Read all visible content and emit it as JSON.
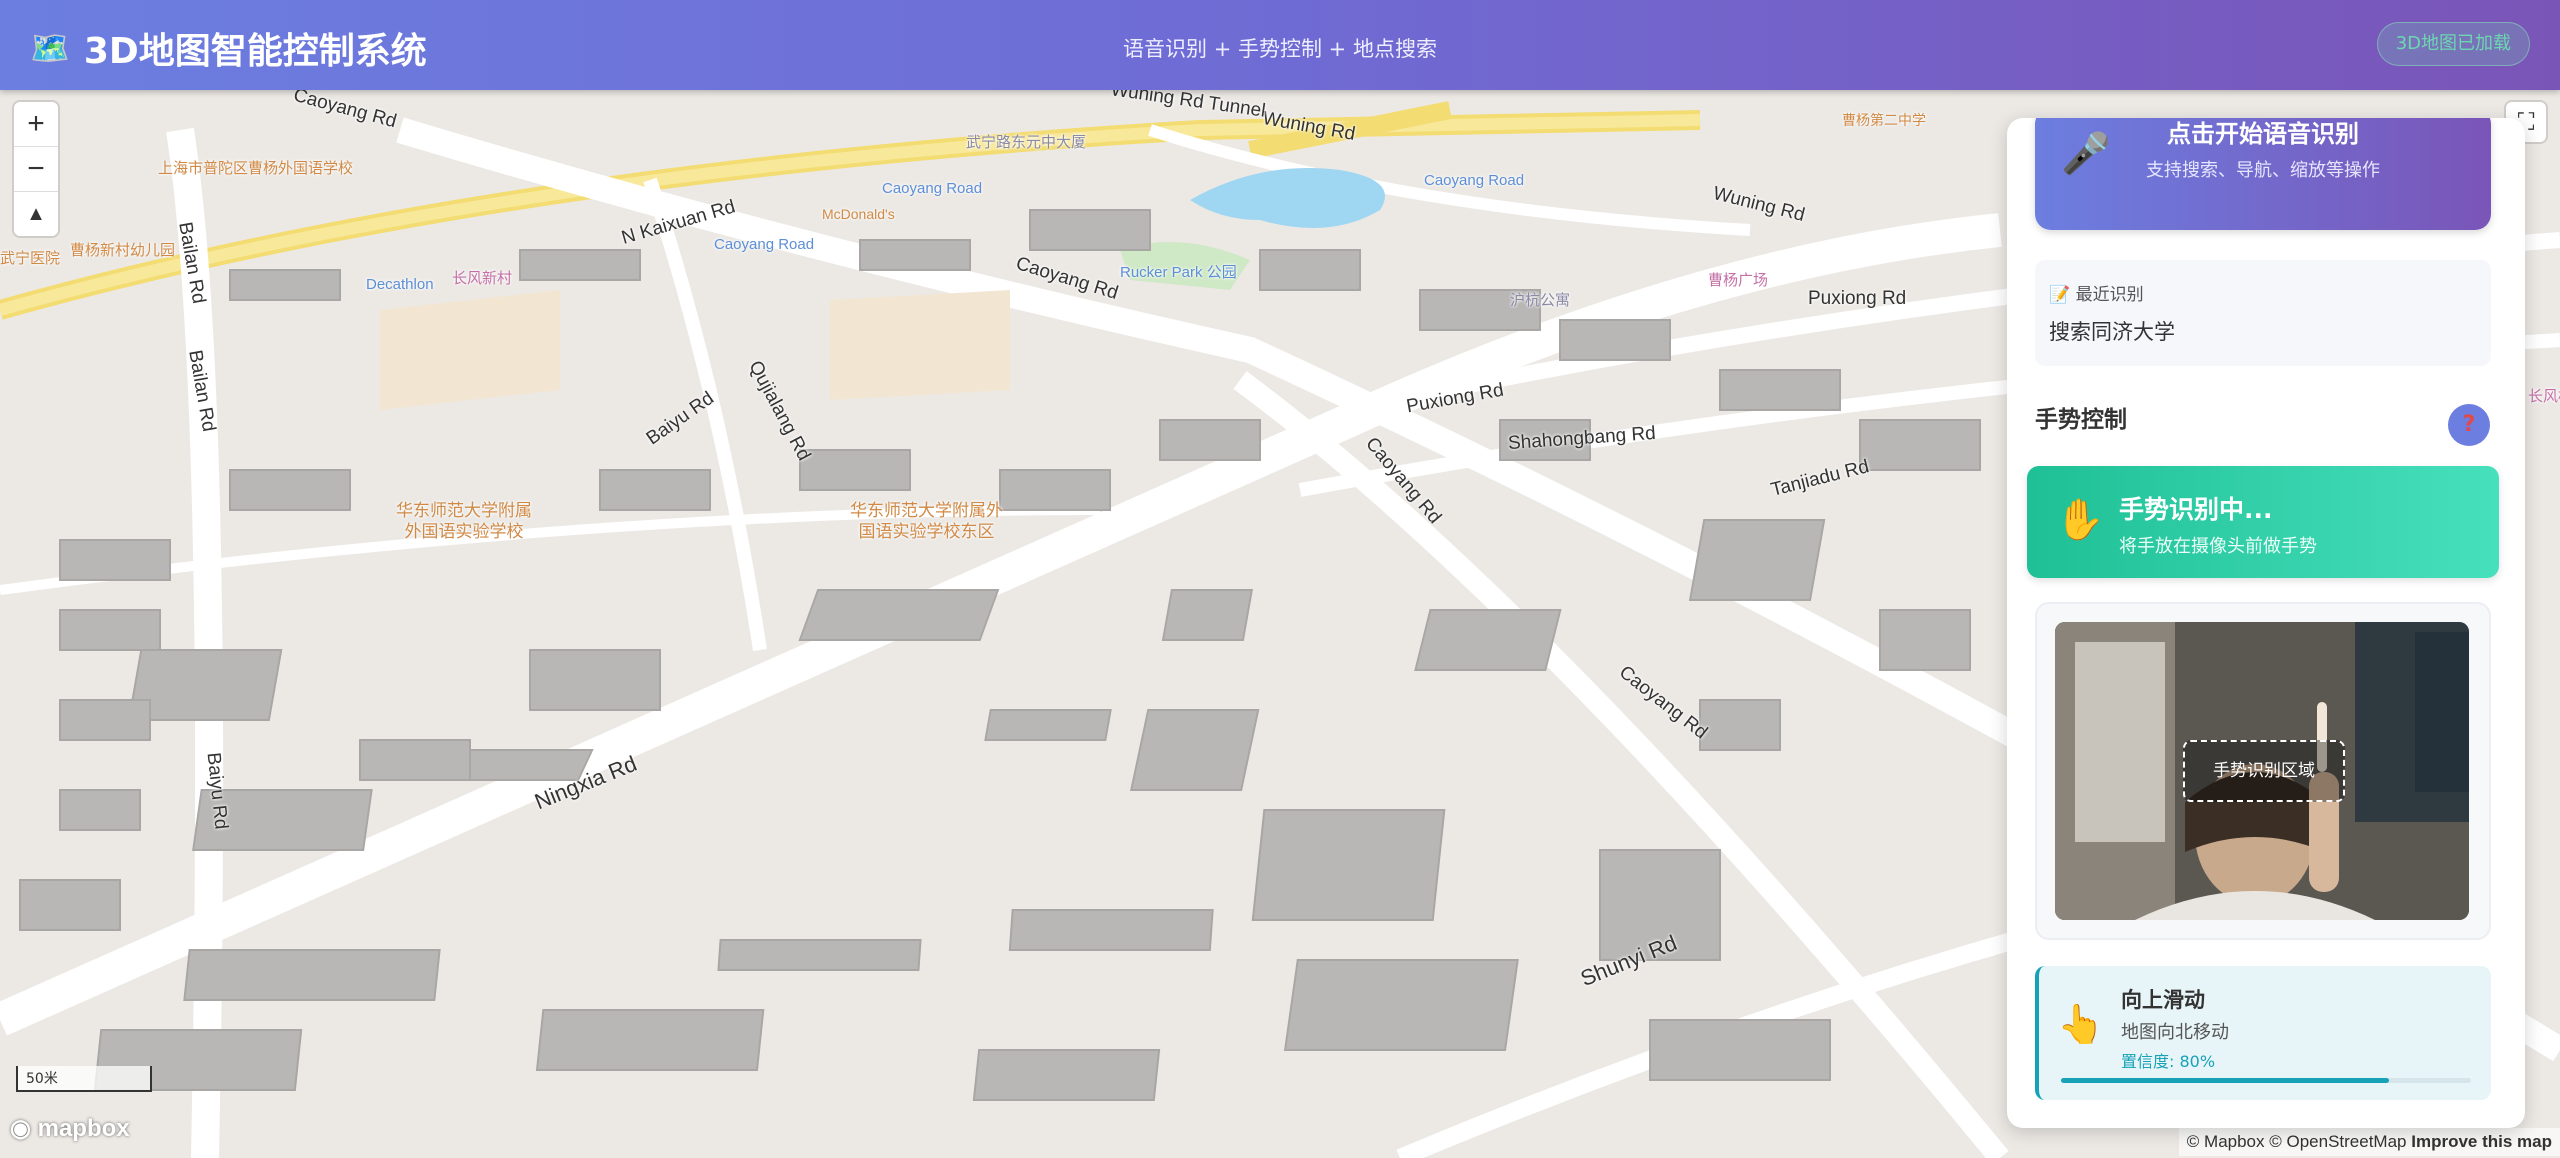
{
  "header": {
    "logo_icon": "map-icon",
    "title": "3D地图智能控制系统",
    "subtitle": "语音识别 + 手势控制 + 地点搜索",
    "status": "3D地图已加载"
  },
  "map": {
    "zoom_in": "+",
    "zoom_out": "−",
    "compass": "▲",
    "fullscreen": "⛶",
    "scale": "50米",
    "logo": "mapbox",
    "attribution_a": "© Mapbox © OpenStreetMap",
    "attribution_b": "Improve this map",
    "streets": {
      "caoyang_1": "Caoyang Rd",
      "caoyang_2": "Caoyang Rd",
      "caoyang_3": "Caoyang Rd",
      "caoyang_4": "Caoyang Rd",
      "wuning_1": "Wuning Rd",
      "wuning_2": "Wuning Rd",
      "tunnel": "Wuning Rd Tunnel",
      "kaixuan": "N Kaixuan Rd",
      "bailan_1": "Bailan Rd",
      "bailan_2": "Bailan Rd",
      "baiyu_1": "Baiyu Rd",
      "baiyu_2": "Baiyu Rd",
      "qujialang": "Qujialang Rd",
      "puxiong_1": "Puxiong Rd",
      "puxiong_2": "Puxiong Rd",
      "shahongbang": "Shahongbang Rd",
      "tanjiadu": "Tanjiadu Rd",
      "ningxia": "Ningxia Rd",
      "shunyi": "Shunyi Rd"
    },
    "pois": {
      "school_left": "上海市普陀区曹杨外国语学校",
      "school_mid": "华东师范大学附属\n外国语实验学校",
      "school_right": "华东师范大学附属外\n国语实验学校东区",
      "kindergarten": "曹杨新村幼儿园",
      "hospital": "武宁医院",
      "mcdonalds": "McDonald's",
      "caoyang_road_1": "Caoyang Road",
      "caoyang_road_2": "Caoyang Road",
      "caoyang_road_3": "Caoyang Road",
      "decathlon": "Decathlon",
      "rucker_park": "Rucker Park 公园",
      "changfeng": "长风新村",
      "plaza": "曹杨广场",
      "park_right": "沪杭公寓",
      "cy_school_2": "曹杨第二中学",
      "top_mall": "武宁路东元中大厦",
      "bridge": "长风桥"
    }
  },
  "panel": {
    "voice": {
      "icon": "microphone-icon",
      "title": "点击开始语音识别",
      "subtitle": "支持搜索、导航、缩放等操作"
    },
    "recent": {
      "icon": "memo-icon",
      "heading": "📝 最近识别",
      "text": "搜索同济大学"
    },
    "gesture": {
      "title": "手势控制",
      "help": "?",
      "status_icon": "raised-hand-icon",
      "status_title": "手势识别中...",
      "status_subtitle": "将手放在摄像头前做手势",
      "camera_zone_label": "手势识别区域"
    },
    "result": {
      "icon": "pointing-up-icon",
      "title": "向上滑动",
      "description": "地图向北移动",
      "confidence_label": "置信度: 80%",
      "confidence": 0.8
    }
  },
  "colors": {
    "header_start": "#6c7ee0",
    "header_end": "#7a55b8",
    "gesture_green": "#1fc096",
    "result_accent": "#17a2b8"
  }
}
